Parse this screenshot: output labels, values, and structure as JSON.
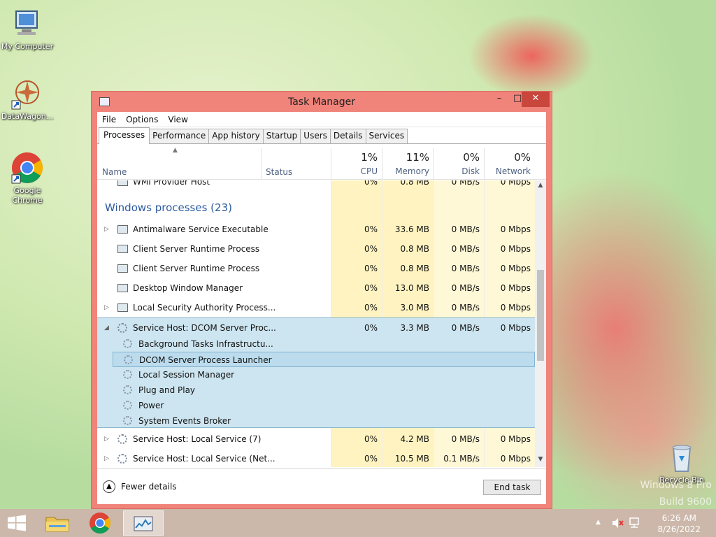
{
  "desktop": {
    "icons": [
      {
        "label": "My Computer"
      },
      {
        "label": "DataWagon..."
      },
      {
        "label": "Google Chrome"
      },
      {
        "label": "Recycle Bin"
      }
    ],
    "watermark_line1": "Windows 8 Pro",
    "watermark_line2": "Build 9600"
  },
  "window": {
    "title": "Task Manager",
    "minimize": "–",
    "maximize": "□",
    "close": "✕"
  },
  "menu": [
    "File",
    "Options",
    "View"
  ],
  "tabs": [
    "Processes",
    "Performance",
    "App history",
    "Startup",
    "Users",
    "Details",
    "Services"
  ],
  "active_tab": "Processes",
  "columns": {
    "name": "Name",
    "status": "Status",
    "cpu": {
      "pct": "1%",
      "label": "CPU"
    },
    "memory": {
      "pct": "11%",
      "label": "Memory"
    },
    "disk": {
      "pct": "0%",
      "label": "Disk"
    },
    "network": {
      "pct": "0%",
      "label": "Network"
    }
  },
  "partial_row": {
    "name": "WMI Provider Host",
    "cpu": "0%",
    "mem": "0.8 MB",
    "disk": "0 MB/s",
    "net": "0 Mbps"
  },
  "group_label": "Windows processes (23)",
  "rows": [
    {
      "name": "Antimalware Service Executable",
      "cpu": "0%",
      "mem": "33.6 MB",
      "disk": "0 MB/s",
      "net": "0 Mbps",
      "expander": "▷"
    },
    {
      "name": "Client Server Runtime Process",
      "cpu": "0%",
      "mem": "0.8 MB",
      "disk": "0 MB/s",
      "net": "0 Mbps",
      "expander": ""
    },
    {
      "name": "Client Server Runtime Process",
      "cpu": "0%",
      "mem": "0.8 MB",
      "disk": "0 MB/s",
      "net": "0 Mbps",
      "expander": ""
    },
    {
      "name": "Desktop Window Manager",
      "cpu": "0%",
      "mem": "13.0 MB",
      "disk": "0 MB/s",
      "net": "0 Mbps",
      "expander": ""
    },
    {
      "name": "Local Security Authority Process...",
      "cpu": "0%",
      "mem": "3.0 MB",
      "disk": "0 MB/s",
      "net": "0 Mbps",
      "expander": "▷"
    }
  ],
  "expanded_row": {
    "name": "Service Host: DCOM Server Proc...",
    "cpu": "0%",
    "mem": "3.3 MB",
    "disk": "0 MB/s",
    "net": "0 Mbps",
    "expander": "◢"
  },
  "sub_items": [
    "Background Tasks Infrastructu...",
    "DCOM Server Process Launcher",
    "Local Session Manager",
    "Plug and Play",
    "Power",
    "System Events Broker"
  ],
  "selected_sub": "DCOM Server Process Launcher",
  "rows_after": [
    {
      "name": "Service Host: Local Service (7)",
      "cpu": "0%",
      "mem": "4.2 MB",
      "disk": "0 MB/s",
      "net": "0 Mbps",
      "expander": "▷"
    },
    {
      "name": "Service Host: Local Service (Net...",
      "cpu": "0%",
      "mem": "10.5 MB",
      "disk": "0.1 MB/s",
      "net": "0 Mbps",
      "expander": "▷"
    }
  ],
  "footer": {
    "fewer_details": "Fewer details",
    "end_task": "End task"
  },
  "taskbar": {
    "time": "6:26 AM",
    "date": "8/26/2022"
  }
}
